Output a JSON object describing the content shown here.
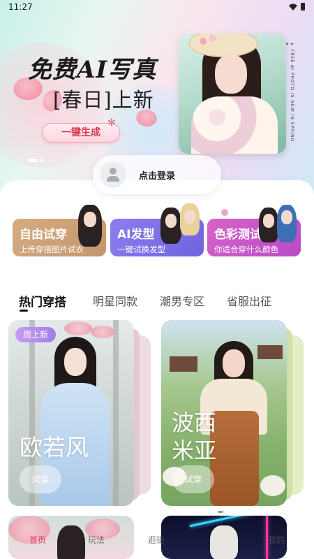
{
  "status_bar": {
    "time": "11:27"
  },
  "hero": {
    "title": "免费AI写真",
    "subtitle": "[春日]上新",
    "button_label": "一键生成",
    "vertical_caption": "✦ FREE AI PHOTO IS NEW IN SPRING ✦"
  },
  "login": {
    "label": "点击登录"
  },
  "features": [
    {
      "label": "自由试穿",
      "desc": "上传穿搭图片试衣"
    },
    {
      "label": "AI发型",
      "desc": "一键试换发型"
    },
    {
      "label": "色彩测试",
      "desc": "你适合穿什么颜色"
    }
  ],
  "tabs": [
    {
      "label": "热门穿搭",
      "active": true
    },
    {
      "label": "明星同款"
    },
    {
      "label": "潮男专区"
    },
    {
      "label": "省服出征"
    }
  ],
  "cards": [
    {
      "badge": "周上新",
      "title": "欧若风",
      "button": "试穿"
    },
    {
      "title_line1": "波西",
      "title_line2": "米亚",
      "button": "试穿"
    }
  ],
  "bottom_nav": [
    {
      "label": "首页",
      "active": true
    },
    {
      "label": "玩法"
    },
    {
      "label": "逛街"
    },
    {
      "label": "我的"
    }
  ],
  "colors": {
    "accent_pink": "#e2405f",
    "feature_tan": "#c3956c",
    "feature_purple": "#6f63de",
    "feature_magenta": "#b84bc7",
    "badge_purple": "#a47ee6"
  }
}
